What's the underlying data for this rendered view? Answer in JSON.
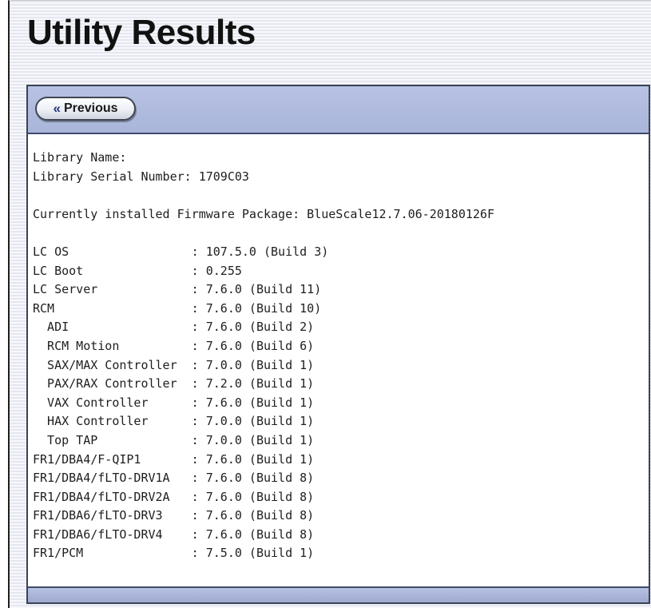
{
  "page": {
    "title": "Utility Results"
  },
  "toolbar": {
    "previous_label": "Previous",
    "previous_icon": "double-chevron-left-icon"
  },
  "results": {
    "text": "Library Name:\nLibrary Serial Number: 1709C03\n\nCurrently installed Firmware Package: BlueScale12.7.06-20180126F\n\nLC OS                 : 107.5.0 (Build 3)\nLC Boot               : 0.255\nLC Server             : 7.6.0 (Build 11)\nRCM                   : 7.6.0 (Build 10)\n  ADI                 : 7.6.0 (Build 2)\n  RCM Motion          : 7.6.0 (Build 6)\n  SAX/MAX Controller  : 7.0.0 (Build 1)\n  PAX/RAX Controller  : 7.2.0 (Build 1)\n  VAX Controller      : 7.6.0 (Build 1)\n  HAX Controller      : 7.0.0 (Build 1)\n  Top TAP             : 7.0.0 (Build 1)\nFR1/DBA4/F-QIP1       : 7.6.0 (Build 1)\nFR1/DBA4/fLTO-DRV1A   : 7.6.0 (Build 8)\nFR1/DBA4/fLTO-DRV2A   : 7.6.0 (Build 8)\nFR1/DBA6/fLTO-DRV3    : 7.6.0 (Build 8)\nFR1/DBA6/fLTO-DRV4    : 7.6.0 (Build 8)\nFR1/PCM               : 7.5.0 (Build 1)"
  },
  "colors": {
    "header_bar": "#b2bde0",
    "panel_border": "#3a4255",
    "background_stripe": "#e5e7f0"
  }
}
